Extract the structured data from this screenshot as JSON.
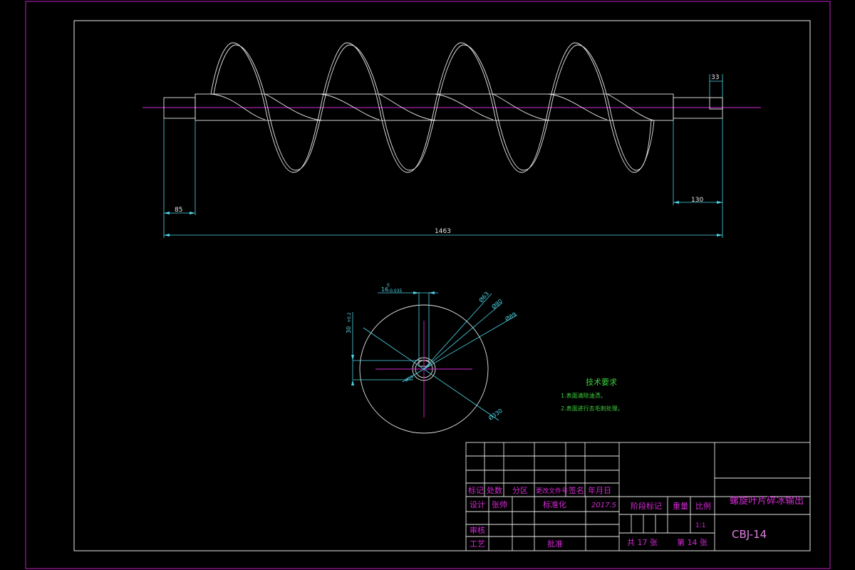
{
  "dimensions": {
    "overall_length": "1463",
    "left_shaft": "85",
    "right_shaft": "130",
    "keyway_width": "33"
  },
  "section": {
    "tol_nominal": "16",
    "tol_upper": "0",
    "tol_lower": "-0.035",
    "depth_nominal": "30",
    "depth_tol": "+0.2",
    "dia_shaft": "Ø63",
    "dia_tube1": "Ø80",
    "dia_tube2": "Ø89",
    "dia_blade": "Ø330",
    "small_label": "Ø19"
  },
  "requirements": {
    "title": "技术要求",
    "items": [
      "1.表面清除油渍。",
      "2.表面进行去毛刺处理。"
    ]
  },
  "title_block": {
    "hdr_mark": "标记",
    "hdr_count": "处数",
    "hdr_zone": "分区",
    "hdr_docno": "更改文件号",
    "hdr_sign": "签名",
    "hdr_date": "年月日",
    "design_label": "设计",
    "designer": "张帅",
    "std_label": "标准化",
    "date": "2017.5",
    "review_label": "审核",
    "process_label": "工艺",
    "approve_label": "批准",
    "stage_label": "阶段标记",
    "weight_label": "重量",
    "scale_label": "比例",
    "scale_value": "1:1",
    "total_sheets": "共 17 张",
    "sheet_no": "第 14 张",
    "part_name": "螺旋叶片碎冰输出",
    "drawing_no": "CBJ-14"
  }
}
